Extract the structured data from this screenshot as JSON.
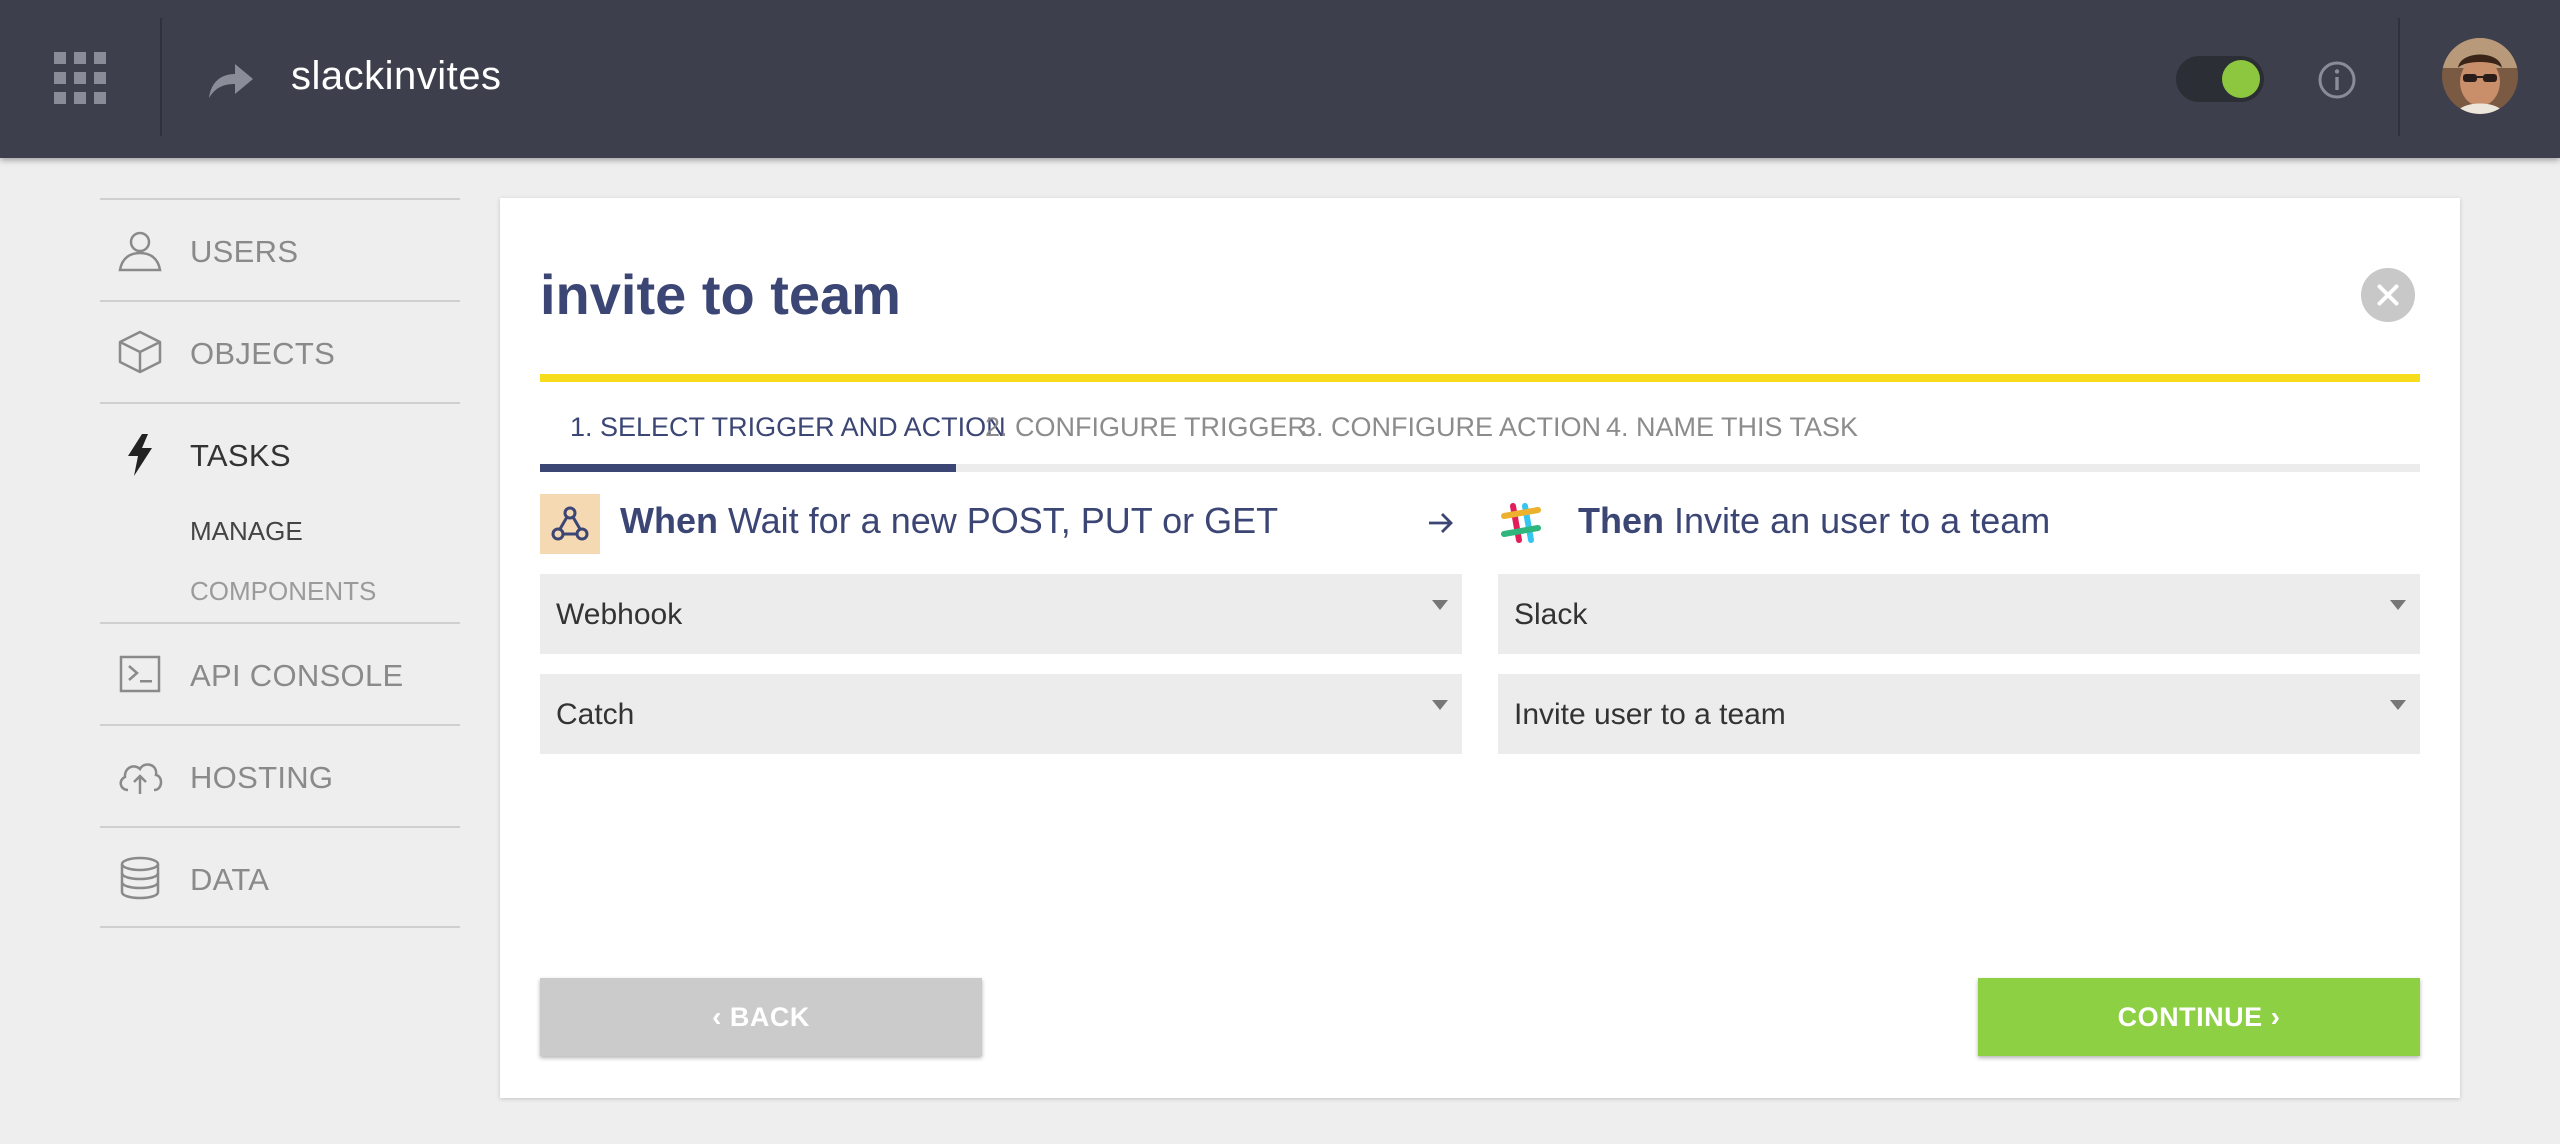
{
  "header": {
    "app_name": "slackinvites",
    "icons": {
      "apps": "grid-icon",
      "project": "share-arrow-icon",
      "info": "info-icon"
    },
    "toggle_on": true,
    "accent_color": "#8dc63f"
  },
  "sidebar": {
    "items": [
      {
        "label": "USERS",
        "icon": "user-icon"
      },
      {
        "label": "OBJECTS",
        "icon": "cube-icon"
      },
      {
        "label": "TASKS",
        "icon": "lightning-icon",
        "active": true
      },
      {
        "label": "API CONSOLE",
        "icon": "terminal-icon"
      },
      {
        "label": "HOSTING",
        "icon": "cloud-upload-icon"
      },
      {
        "label": "DATA",
        "icon": "database-icon"
      }
    ],
    "tasks_sub": [
      {
        "label": "MANAGE"
      },
      {
        "label": "COMPONENTS"
      }
    ]
  },
  "card": {
    "title": "invite to team",
    "tabs": [
      {
        "label": "1. SELECT TRIGGER AND ACTION",
        "active": true
      },
      {
        "label": "2. CONFIGURE TRIGGER"
      },
      {
        "label": "3. CONFIGURE ACTION"
      },
      {
        "label": "4. NAME THIS TASK"
      }
    ],
    "trigger": {
      "prefix": "When",
      "text": "Wait for a new POST, PUT or GET",
      "service": "Webhook",
      "event": "Catch"
    },
    "action": {
      "prefix": "Then",
      "text": "Invite an user to a team",
      "service": "Slack",
      "event": "Invite user to a team"
    },
    "back_label": "BACK",
    "continue_label": "CONTINUE",
    "colors": {
      "primary": "#3b4675",
      "progress": "#f7dc1b",
      "continue": "#8dd043"
    }
  }
}
